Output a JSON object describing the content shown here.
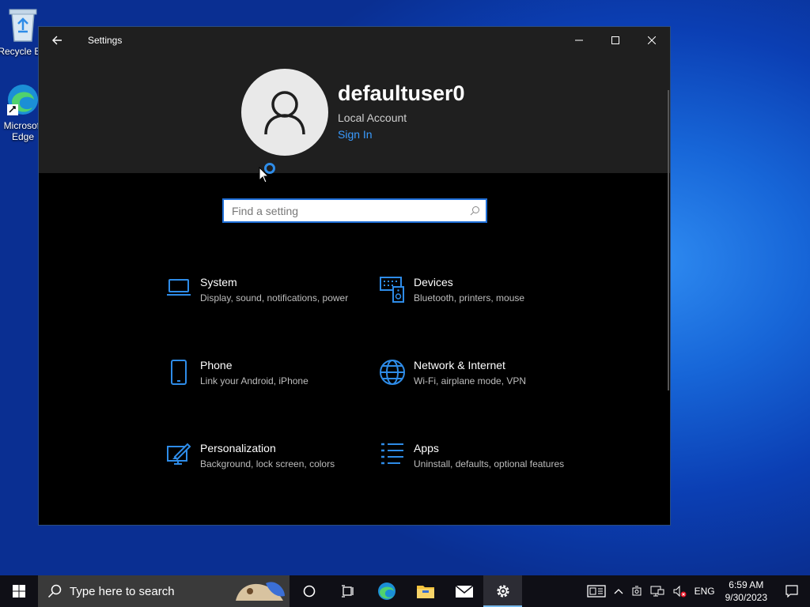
{
  "desktop": {
    "icons": [
      {
        "label": "Recycle Bin",
        "icon": "recycle-bin-icon"
      },
      {
        "label": "Microsoft Edge",
        "icon": "edge-icon"
      }
    ]
  },
  "window": {
    "title": "Settings",
    "controls": [
      "minimize-icon",
      "maximize-icon",
      "close-icon"
    ]
  },
  "profile": {
    "username": "defaultuser0",
    "account_type": "Local Account",
    "sign_in_label": "Sign In"
  },
  "search": {
    "placeholder": "Find a setting",
    "value": ""
  },
  "categories": [
    {
      "title": "System",
      "desc": "Display, sound, notifications, power",
      "icon": "laptop-icon"
    },
    {
      "title": "Devices",
      "desc": "Bluetooth, printers, mouse",
      "icon": "devices-icon"
    },
    {
      "title": "Phone",
      "desc": "Link your Android, iPhone",
      "icon": "phone-icon"
    },
    {
      "title": "Network & Internet",
      "desc": "Wi-Fi, airplane mode, VPN",
      "icon": "globe-icon"
    },
    {
      "title": "Personalization",
      "desc": "Background, lock screen, colors",
      "icon": "paint-icon"
    },
    {
      "title": "Apps",
      "desc": "Uninstall, defaults, optional features",
      "icon": "apps-list-icon"
    }
  ],
  "taskbar": {
    "search_placeholder": "Type here to search",
    "language": "ENG",
    "time": "6:59 AM",
    "date": "9/30/2023"
  },
  "colors": {
    "accent": "#3a9bff",
    "icon_blue": "#2e8ce8",
    "window_bg": "#000000",
    "banner_bg": "#1f1f1f"
  }
}
